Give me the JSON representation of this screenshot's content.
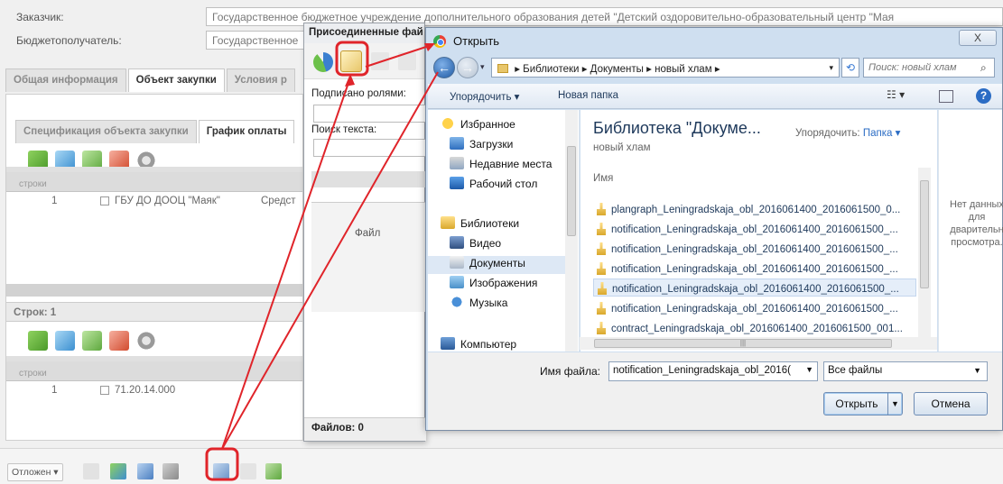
{
  "app": {
    "customer_label": "Заказчик:",
    "customer_value": "Государственное бюджетное учреждение дополнительного образования детей \"Детский оздоровительно-образовательный центр \"Мая",
    "recipient_label": "Бюджетополучатель:",
    "recipient_value": "Государственное",
    "tabs": [
      "Общая информация",
      "Объект закупки",
      "Условия р"
    ],
    "subtabs": [
      "Спецификация объекта закупки",
      "График оплаты"
    ],
    "grid1": {
      "header_row_col": "строки",
      "row_num": "1",
      "row_org": "ГБУ ДО ДООЦ \"Маяк\"",
      "row_src": "Средст"
    },
    "rows_count_label": "Строк: 1",
    "grid2": {
      "header_row_col": "строки",
      "row_num": "1",
      "row_code": "71.20.14.000"
    },
    "bottom": {
      "deferred_label": "Отложен"
    }
  },
  "attach_window": {
    "title": "Присоединенные фай",
    "signed_label": "Подписано ролями:",
    "search_label": "Поиск текста:",
    "file_col": "Файл",
    "files_count": "Файлов: 0"
  },
  "dialog": {
    "title": "Открыть",
    "close_symbol": "X",
    "breadcrumb": [
      "Библиотеки",
      "Документы",
      "новый хлам"
    ],
    "search_placeholder": "Поиск: новый хлам",
    "organize": "Упорядочить ▾",
    "new_folder": "Новая папка",
    "nav": {
      "favorites": "Избранное",
      "downloads": "Загрузки",
      "recent": "Недавние места",
      "desktop": "Рабочий стол",
      "libraries": "Библиотеки",
      "video": "Видео",
      "documents": "Документы",
      "images": "Изображения",
      "music": "Музыка",
      "computer": "Компьютер"
    },
    "library_title": "Библиотека \"Докуме...",
    "library_sub": "новый хлам",
    "arrange_label": "Упорядочить:",
    "arrange_value": "Папка ▾",
    "column_name": "Имя",
    "files": [
      "plangraph_Leningradskaja_obl_2016061400_2016061500_0...",
      "notification_Leningradskaja_obl_2016061400_2016061500_...",
      "notification_Leningradskaja_obl_2016061400_2016061500_...",
      "notification_Leningradskaja_obl_2016061400_2016061500_...",
      "notification_Leningradskaja_obl_2016061400_2016061500_...",
      "notification_Leningradskaja_obl_2016061400_2016061500_...",
      "contract_Leningradskaja_obl_2016061400_2016061500_001..."
    ],
    "preview_text": "Нет данных для дварительн просмотра.",
    "filename_label": "Имя файла:",
    "filename_value": "notification_Leningradskaja_obl_2016(",
    "filetype_value": "Все файлы",
    "open_button": "Открыть",
    "cancel_button": "Отмена"
  },
  "colors": {
    "highlight": "#e0242a",
    "accent": "#2b6cc4"
  }
}
